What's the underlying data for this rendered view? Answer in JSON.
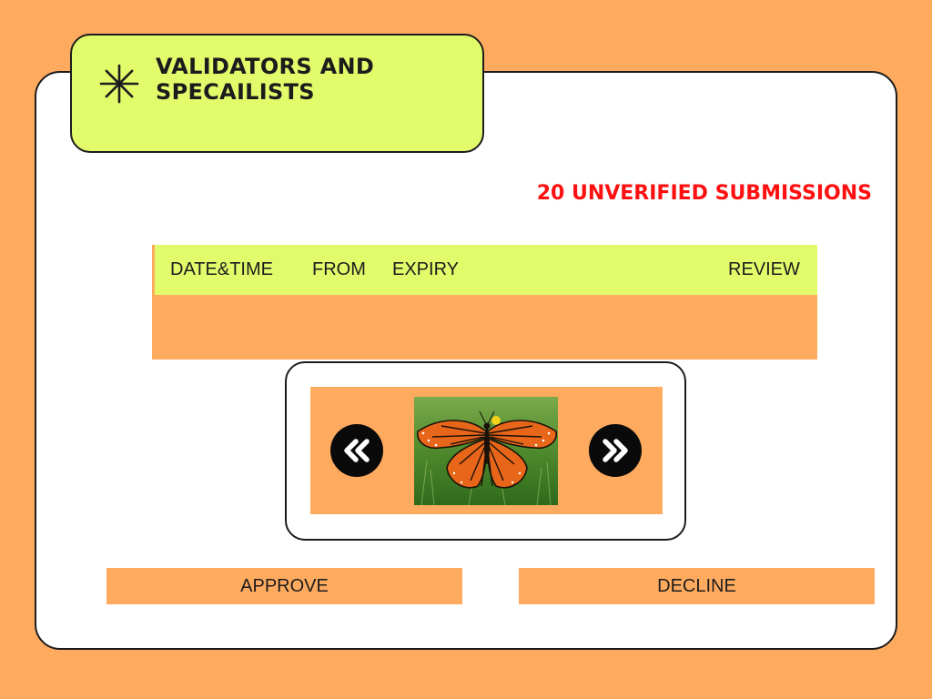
{
  "header": {
    "title": "VALIDATORS AND SPECAILISTS",
    "icon": "asterisk-icon"
  },
  "status": {
    "unverified": "20 UNVERIFIED SUBMISSIONS"
  },
  "table": {
    "columns": [
      "DATE&TIME",
      "FROM",
      "EXPIRY",
      "REVIEW"
    ],
    "rows": []
  },
  "viewer": {
    "prev_icon": "double-chevron-left-icon",
    "next_icon": "double-chevron-right-icon",
    "image": "monarch-butterfly-photo"
  },
  "actions": {
    "approve": "APPROVE",
    "decline": "DECLINE"
  },
  "colors": {
    "background": "#ffab5f",
    "accent": "#e1fb6b",
    "alert": "#ff1010",
    "dark": "#1c1c1c"
  }
}
